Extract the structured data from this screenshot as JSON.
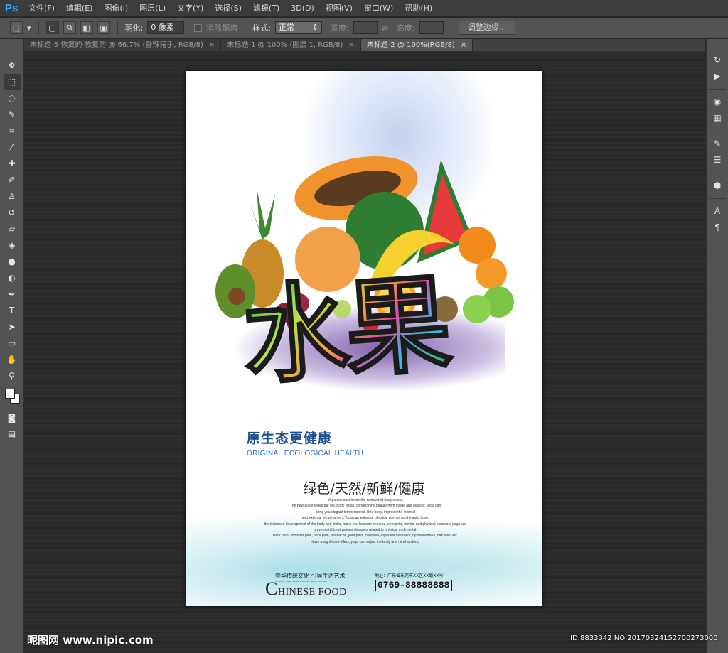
{
  "app": {
    "logo": "Ps"
  },
  "menu": [
    "文件(F)",
    "编辑(E)",
    "图像(I)",
    "图层(L)",
    "文字(Y)",
    "选择(S)",
    "滤镜(T)",
    "3D(D)",
    "视图(V)",
    "窗口(W)",
    "帮助(H)"
  ],
  "options": {
    "feather_label": "羽化:",
    "feather_value": "0 像素",
    "antialias_label": "消除锯齿",
    "style_label": "样式:",
    "style_value": "正常",
    "width_label": "宽度:",
    "height_label": "高度:",
    "refine_edge_label": "调整边缘..."
  },
  "tabs": [
    {
      "label": "未标题-5-恢复的-恢复的 @ 66.7% (香辣猪手, RGB/8)",
      "close": "×",
      "active": false
    },
    {
      "label": "未标题-1 @ 100% (图层 1, RGB/8)",
      "close": "×",
      "active": false
    },
    {
      "label": "未标题-2 @ 100%(RGB/8)",
      "close": "×",
      "active": true
    }
  ],
  "poster": {
    "title": "水果",
    "slogan_cn": "原生态更健康",
    "slogan_en": "ORIGINAL ECOLOGICAL HEALTH",
    "tagline": "绿色/天然/新鲜/健康",
    "body_lines": [
      "Yoga can accelerate the removal of body waste,",
      "The new supersedes the old, body repair, conditioning beauty from inside and outside; yoga can",
      "bring you elegant temperament, lithe body; improve the internal",
      "and external temperament.Yoga can enhance physical strength and elastic body,",
      "the balanced development of the body and limbs, make you become cheerful, energetic, mental and physical pleasure; yoga can",
      "prevent and treat various diseases related to physical and mental,",
      "Back pain, shoulder pain, neck pain, headache, joint pain, insomnia, digestive disorders, dysmenorrhea, hair loss, etc.",
      "have a significant effect; yoga can adjust the body and mind system,"
    ],
    "footer_cn": "中华传统文化 引导生活艺术",
    "footer_cn_small": "CHINESE TRADITIONAL CULTURE GUIDE LIFE ART",
    "footer_en_first": "C",
    "footer_en_rest": "HINESE FOOD",
    "address": "地址：广东省东莞市XX区XX路XX号",
    "phone": "0769-88888888"
  },
  "watermark": {
    "left": "昵图网 www.nipic.com",
    "right": "ID:8833342 NO:20170324152700273000"
  },
  "colors": {
    "ps_blue": "#31a8ff",
    "slogan_blue": "#1d4f8f",
    "workspace": "#2b2b2b"
  }
}
